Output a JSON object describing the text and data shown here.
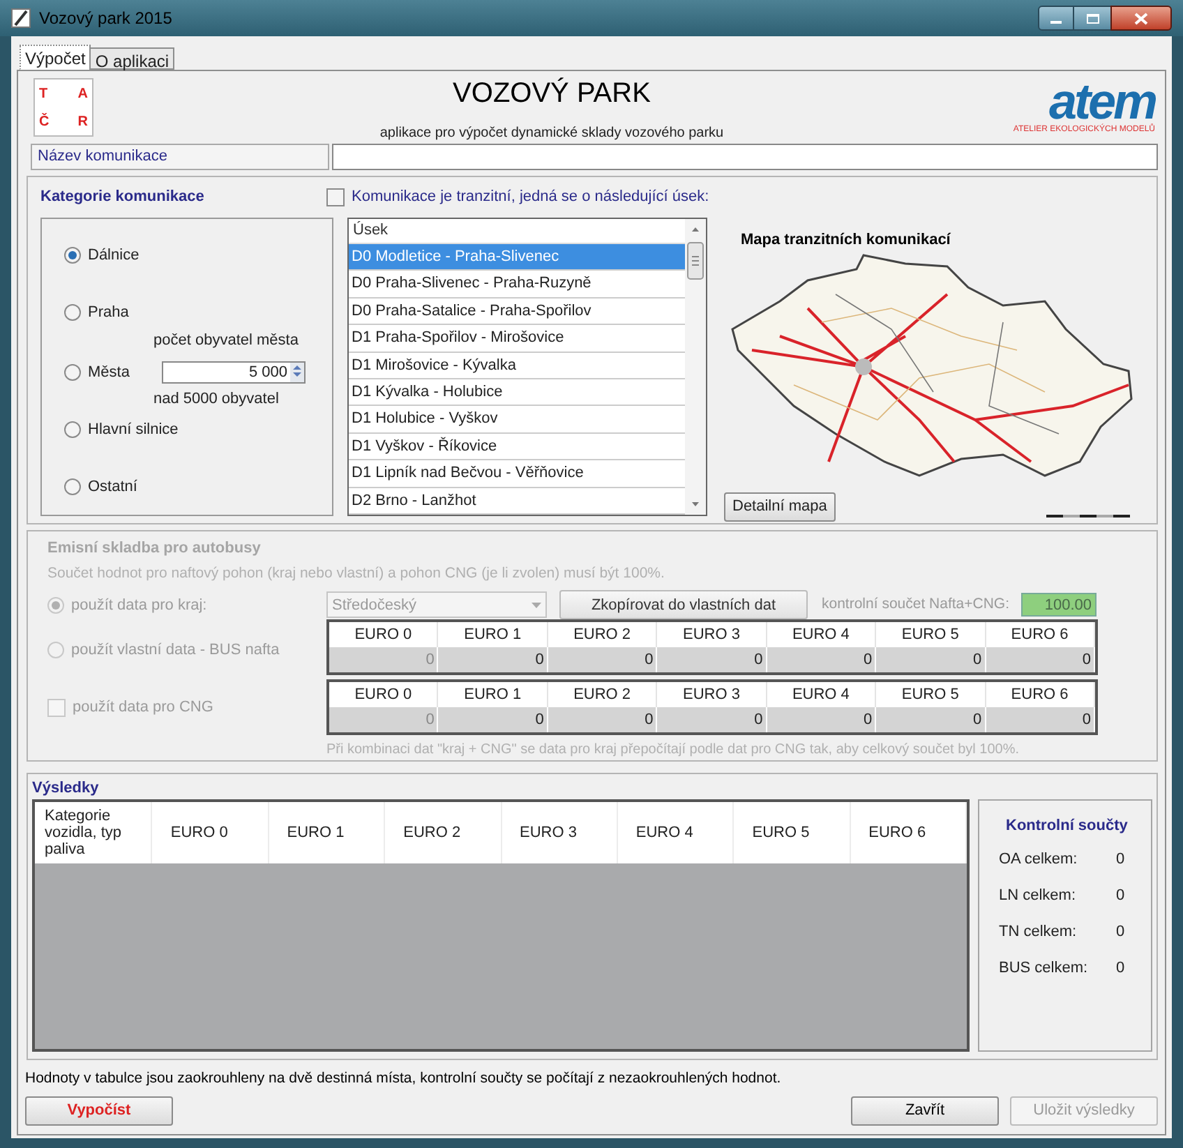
{
  "window": {
    "title": "Vozový park 2015"
  },
  "tabs": [
    {
      "label": "Výpočet",
      "selected": true
    },
    {
      "label": "O aplikaci",
      "selected": false
    }
  ],
  "header": {
    "logo_letters": [
      "T",
      "A",
      "Č",
      "R"
    ],
    "title": "VOZOVÝ PARK",
    "subtitle": "aplikace pro výpočet dynamické sklady vozového parku",
    "brand": "atem",
    "brand_caption": "ATELIER EKOLOGICKÝCH MODELŮ"
  },
  "name_field": {
    "label": "Název komunikace"
  },
  "category": {
    "title": "Kategorie komunikace",
    "transit": {
      "label": "Komunikace je tranzitní, jedná se o následující úsek:",
      "checked": false
    },
    "options": [
      {
        "kind": "plain",
        "label": "Dálnice",
        "selected": true
      },
      {
        "kind": "plain",
        "label": "Praha",
        "selected": false
      },
      {
        "kind": "population",
        "label": "Města",
        "selected": false,
        "caption": "počet obyvatel města",
        "value": "5 000",
        "note": "nad 5000 obyvatel"
      },
      {
        "kind": "plain",
        "label": "Hlavní silnice",
        "selected": false
      },
      {
        "kind": "plain",
        "label": "Ostatní",
        "selected": false
      }
    ],
    "segments": {
      "header": "Úsek",
      "rows": [
        {
          "label": "D0 Modletice - Praha-Slivenec",
          "selected": true
        },
        {
          "label": "D0 Praha-Slivenec - Praha-Ruzyně",
          "selected": false
        },
        {
          "label": "D0 Praha-Satalice - Praha-Spořilov",
          "selected": false
        },
        {
          "label": "D1 Praha-Spořilov - Mirošovice",
          "selected": false
        },
        {
          "label": "D1 Mirošovice - Kývalka",
          "selected": false
        },
        {
          "label": "D1 Kývalka - Holubice",
          "selected": false
        },
        {
          "label": "D1 Holubice - Vyškov",
          "selected": false
        },
        {
          "label": "D1 Vyškov - Říkovice",
          "selected": false
        },
        {
          "label": "D1 Lipník nad Bečvou - Věřňovice",
          "selected": false
        },
        {
          "label": "D2 Brno - Lanžhot",
          "selected": false
        }
      ]
    },
    "map": {
      "title": "Mapa tranzitních komunikací",
      "button": "Detailní mapa"
    }
  },
  "emission": {
    "title": "Emisní skladba pro autobusy",
    "disabled": true,
    "note": "Součet hodnot pro naftový pohon (kraj nebo vlastní) a pohon CNG (je li zvolen) musí být 100%.",
    "region": {
      "label": "použít data pro kraj:",
      "selected": true,
      "dropdown": "Středočeský",
      "copy_button": "Zkopírovat do vlastních dat",
      "sum_label": "kontrolní součet Nafta+CNG:",
      "sum_value": "100.00"
    },
    "own": {
      "label": "použít vlastní data - BUS nafta",
      "selected": false
    },
    "cng": {
      "label": "použít data pro CNG",
      "checked": false
    },
    "grids": [
      {
        "columns": [
          "EURO 0",
          "EURO 1",
          "EURO 2",
          "EURO 3",
          "EURO 4",
          "EURO 5",
          "EURO 6"
        ],
        "values": [
          "0",
          "0",
          "0",
          "0",
          "0",
          "0",
          "0"
        ]
      },
      {
        "columns": [
          "EURO 0",
          "EURO 1",
          "EURO 2",
          "EURO 3",
          "EURO 4",
          "EURO 5",
          "EURO 6"
        ],
        "values": [
          "0",
          "0",
          "0",
          "0",
          "0",
          "0",
          "0"
        ]
      }
    ],
    "footnote": "Při kombinaci dat \"kraj + CNG\" se data pro kraj přepočítají podle dat pro CNG tak, aby celkový součet byl 100%."
  },
  "results": {
    "title": "Výsledky",
    "columns": [
      "Kategorie vozidla, typ paliva",
      "EURO 0",
      "EURO 1",
      "EURO 2",
      "EURO 3",
      "EURO 4",
      "EURO 5",
      "EURO 6"
    ],
    "totals": {
      "title": "Kontrolní součty",
      "rows": [
        {
          "label": "OA celkem:",
          "value": "0"
        },
        {
          "label": "LN celkem:",
          "value": "0"
        },
        {
          "label": "TN celkem:",
          "value": "0"
        },
        {
          "label": "BUS celkem:",
          "value": "0"
        }
      ]
    }
  },
  "footer_note": "Hodnoty v tabulce jsou zaokrouhleny na dvě destinná místa, kontrolní součty se počítají z nezaokrouhlených hodnot.",
  "buttons": [
    {
      "kind": "primary",
      "label": "Vypočíst",
      "disabled": false
    },
    {
      "kind": "close",
      "label": "Zavřít",
      "disabled": false
    },
    {
      "kind": "save",
      "label": "Uložit výsledky",
      "disabled": true
    }
  ]
}
